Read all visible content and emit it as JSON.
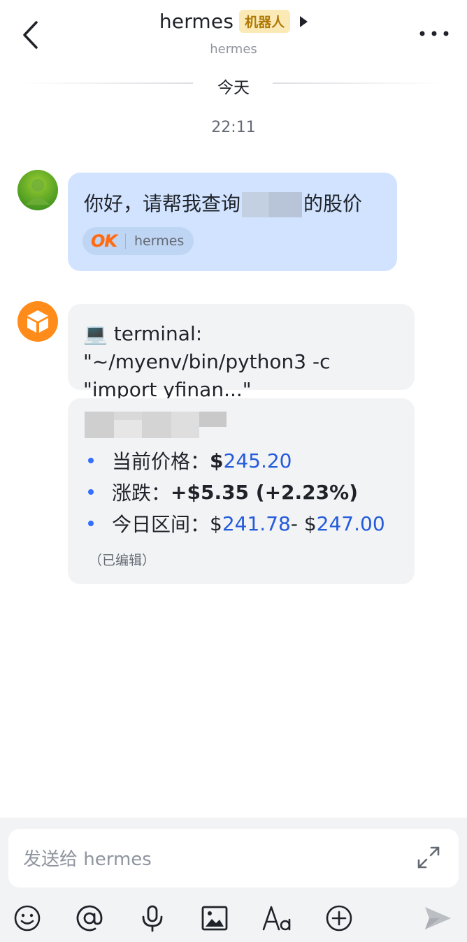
{
  "header": {
    "title": "hermes",
    "badge": "机器人",
    "subtitle": "hermes"
  },
  "timeline": {
    "date_label": "今天",
    "time_label": "22:11"
  },
  "messages": {
    "user": {
      "text_before": "你好，请帮我查询",
      "text_after": "的股价",
      "chip_logo": "OK",
      "chip_label": "hermes"
    },
    "bot_tool": {
      "text": "💻 terminal: \"~/myenv/bin/python3 -c \"import yfinan...\""
    },
    "bot_result": {
      "items": [
        {
          "label": "当前价格：",
          "prefix": "$",
          "value": "245.20"
        },
        {
          "label": "涨跌：",
          "value": "+$5.35 (+2.23%)"
        },
        {
          "label": "今日区间：",
          "prefix": "$",
          "low": "241.78",
          "sep": " - $",
          "high": "247.00"
        }
      ],
      "edited": "（已编辑）"
    }
  },
  "composer": {
    "placeholder": "发送给 hermes",
    "toolbar": [
      "emoji-icon",
      "mention-icon",
      "microphone-icon",
      "image-icon",
      "font-format-icon",
      "add-icon",
      "send-icon"
    ]
  },
  "colors": {
    "user_bubble": "#d1e3ff",
    "bot_bubble": "#f2f3f5",
    "accent_blue": "#245bdb",
    "badge_bg": "#fbeab5",
    "badge_text": "#b07a08"
  }
}
